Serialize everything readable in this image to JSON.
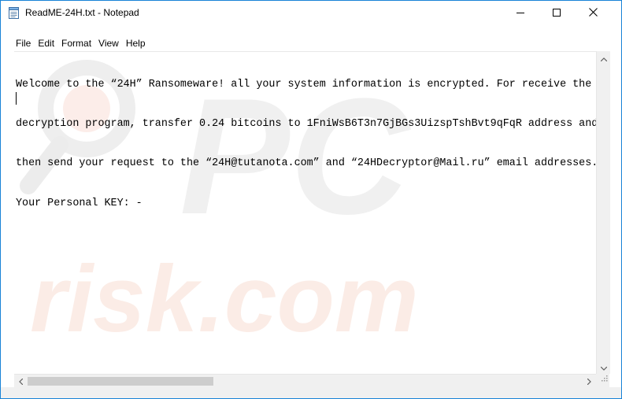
{
  "window": {
    "title": "ReadME-24H.txt - Notepad",
    "accent_color": "#1883d7"
  },
  "menu": [
    {
      "label": "File"
    },
    {
      "label": "Edit"
    },
    {
      "label": "Format"
    },
    {
      "label": "View"
    },
    {
      "label": "Help"
    }
  ],
  "document": {
    "lines": [
      "Welcome to the “24H” Ransomeware! all your system information is encrypted. For receive the",
      "decryption program, transfer 0.24 bitcoins to 1FniWsB6T3n7GjBGs3UizspTshBvt9qFqR address and",
      "then send your request to the “24H@tutanota.com” and “24HDecryptor@Mail.ru” email addresses.",
      "Your Personal KEY: -"
    ]
  },
  "watermark": {
    "text_line1": "PC",
    "text_line2": "risk.com"
  },
  "icons": {
    "app": "notepad-icon",
    "minimize": "minimize-icon",
    "maximize": "maximize-icon",
    "close": "close-icon"
  }
}
